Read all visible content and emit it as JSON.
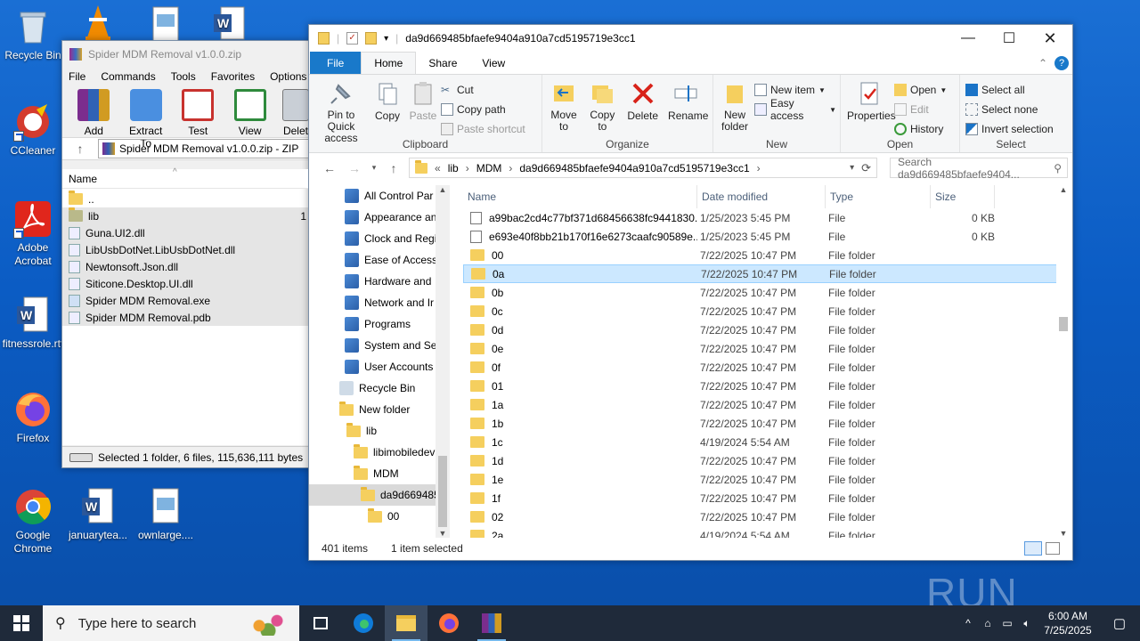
{
  "desktop": {
    "icons": [
      {
        "label": "Recycle Bin"
      },
      {
        "label": "CCleaner"
      },
      {
        "label": "Adobe Acrobat"
      },
      {
        "label": "fitnessrole.rtf"
      },
      {
        "label": "Firefox"
      },
      {
        "label": "Google Chrome"
      },
      {
        "label": "januarytea..."
      },
      {
        "label": "ownlarge...."
      }
    ],
    "watermark": "ANY RUN"
  },
  "winrar": {
    "title": "Spider MDM Removal v1.0.0.zip",
    "menu": [
      "File",
      "Commands",
      "Tools",
      "Favorites",
      "Options",
      "H"
    ],
    "toolbar": [
      "Add",
      "Extract To",
      "Test",
      "View",
      "Delet"
    ],
    "path": "Spider MDM Removal v1.0.0.zip - ZIP",
    "column_name": "Name",
    "files": [
      {
        "name": "..",
        "type": "folder"
      },
      {
        "name": "lib",
        "type": "folder",
        "extra": "1"
      },
      {
        "name": "Guna.UI2.dll",
        "type": "file"
      },
      {
        "name": "LibUsbDotNet.LibUsbDotNet.dll",
        "type": "file"
      },
      {
        "name": "Newtonsoft.Json.dll",
        "type": "file"
      },
      {
        "name": "Siticone.Desktop.UI.dll",
        "type": "file"
      },
      {
        "name": "Spider MDM Removal.exe",
        "type": "exe"
      },
      {
        "name": "Spider MDM Removal.pdb",
        "type": "file"
      }
    ],
    "status": "Selected 1 folder, 6 files, 115,636,111 bytes"
  },
  "explorer": {
    "title": "da9d669485bfaefe9404a910a7cd5195719e3cc1",
    "tabs": [
      "File",
      "Home",
      "Share",
      "View"
    ],
    "ribbon": {
      "clipboard": {
        "pin": "Pin to Quick access",
        "copy": "Copy",
        "paste": "Paste",
        "cut": "Cut",
        "copy_path": "Copy path",
        "paste_shortcut": "Paste shortcut",
        "label": "Clipboard"
      },
      "organize": {
        "move": "Move to",
        "copy": "Copy to",
        "delete": "Delete",
        "rename": "Rename",
        "label": "Organize"
      },
      "new": {
        "new_folder": "New folder",
        "new_item": "New item",
        "easy_access": "Easy access",
        "label": "New"
      },
      "open": {
        "properties": "Properties",
        "open": "Open",
        "edit": "Edit",
        "history": "History",
        "label": "Open"
      },
      "select": {
        "all": "Select all",
        "none": "Select none",
        "invert": "Invert selection",
        "label": "Select"
      }
    },
    "breadcrumb": [
      "«",
      "lib",
      "MDM",
      "da9d669485bfaefe9404a910a7cd5195719e3cc1"
    ],
    "search_placeholder": "Search da9d669485bfaefe9404...",
    "nav": [
      {
        "label": "All Control Par",
        "indent": 40,
        "icon": "cp"
      },
      {
        "label": "Appearance an",
        "indent": 40,
        "icon": "cp"
      },
      {
        "label": "Clock and Regi",
        "indent": 40,
        "icon": "cp"
      },
      {
        "label": "Ease of Access",
        "indent": 40,
        "icon": "cp"
      },
      {
        "label": "Hardware and",
        "indent": 40,
        "icon": "cp"
      },
      {
        "label": "Network and Ir",
        "indent": 40,
        "icon": "cp"
      },
      {
        "label": "Programs",
        "indent": 40,
        "icon": "cp"
      },
      {
        "label": "System and Sec",
        "indent": 40,
        "icon": "cp"
      },
      {
        "label": "User Accounts",
        "indent": 40,
        "icon": "cp"
      },
      {
        "label": "Recycle Bin",
        "indent": 34,
        "icon": "bin"
      },
      {
        "label": "New folder",
        "indent": 34,
        "icon": "folder"
      },
      {
        "label": "lib",
        "indent": 42,
        "icon": "folder"
      },
      {
        "label": "libimobiledev",
        "indent": 50,
        "icon": "folder"
      },
      {
        "label": "MDM",
        "indent": 50,
        "icon": "folder"
      },
      {
        "label": "da9d669485",
        "indent": 58,
        "icon": "folder",
        "selected": true
      },
      {
        "label": "00",
        "indent": 66,
        "icon": "folder"
      }
    ],
    "columns": [
      "Name",
      "Date modified",
      "Type",
      "Size"
    ],
    "files": [
      {
        "name": "a99bac2cd4c77bf371d68456638fc9441830...",
        "date": "1/25/2023 5:45 PM",
        "type": "File",
        "size": "0 KB",
        "kind": "file"
      },
      {
        "name": "e693e40f8bb21b170f16e6273caafc90589e...",
        "date": "1/25/2023 5:45 PM",
        "type": "File",
        "size": "0 KB",
        "kind": "file"
      },
      {
        "name": "00",
        "date": "7/22/2025 10:47 PM",
        "type": "File folder",
        "size": "",
        "kind": "folder"
      },
      {
        "name": "0a",
        "date": "7/22/2025 10:47 PM",
        "type": "File folder",
        "size": "",
        "kind": "folder",
        "selected": true
      },
      {
        "name": "0b",
        "date": "7/22/2025 10:47 PM",
        "type": "File folder",
        "size": "",
        "kind": "folder"
      },
      {
        "name": "0c",
        "date": "7/22/2025 10:47 PM",
        "type": "File folder",
        "size": "",
        "kind": "folder"
      },
      {
        "name": "0d",
        "date": "7/22/2025 10:47 PM",
        "type": "File folder",
        "size": "",
        "kind": "folder"
      },
      {
        "name": "0e",
        "date": "7/22/2025 10:47 PM",
        "type": "File folder",
        "size": "",
        "kind": "folder"
      },
      {
        "name": "0f",
        "date": "7/22/2025 10:47 PM",
        "type": "File folder",
        "size": "",
        "kind": "folder"
      },
      {
        "name": "01",
        "date": "7/22/2025 10:47 PM",
        "type": "File folder",
        "size": "",
        "kind": "folder"
      },
      {
        "name": "1a",
        "date": "7/22/2025 10:47 PM",
        "type": "File folder",
        "size": "",
        "kind": "folder"
      },
      {
        "name": "1b",
        "date": "7/22/2025 10:47 PM",
        "type": "File folder",
        "size": "",
        "kind": "folder"
      },
      {
        "name": "1c",
        "date": "4/19/2024 5:54 AM",
        "type": "File folder",
        "size": "",
        "kind": "folder"
      },
      {
        "name": "1d",
        "date": "7/22/2025 10:47 PM",
        "type": "File folder",
        "size": "",
        "kind": "folder"
      },
      {
        "name": "1e",
        "date": "7/22/2025 10:47 PM",
        "type": "File folder",
        "size": "",
        "kind": "folder"
      },
      {
        "name": "1f",
        "date": "7/22/2025 10:47 PM",
        "type": "File folder",
        "size": "",
        "kind": "folder"
      },
      {
        "name": "02",
        "date": "7/22/2025 10:47 PM",
        "type": "File folder",
        "size": "",
        "kind": "folder"
      },
      {
        "name": "2a",
        "date": "4/19/2024 5:54 AM",
        "type": "File folder",
        "size": "",
        "kind": "folder"
      }
    ],
    "status": {
      "count": "401 items",
      "selected": "1 item selected"
    }
  },
  "taskbar": {
    "search_placeholder": "Type here to search",
    "time": "6:00 AM",
    "date": "7/25/2025"
  }
}
